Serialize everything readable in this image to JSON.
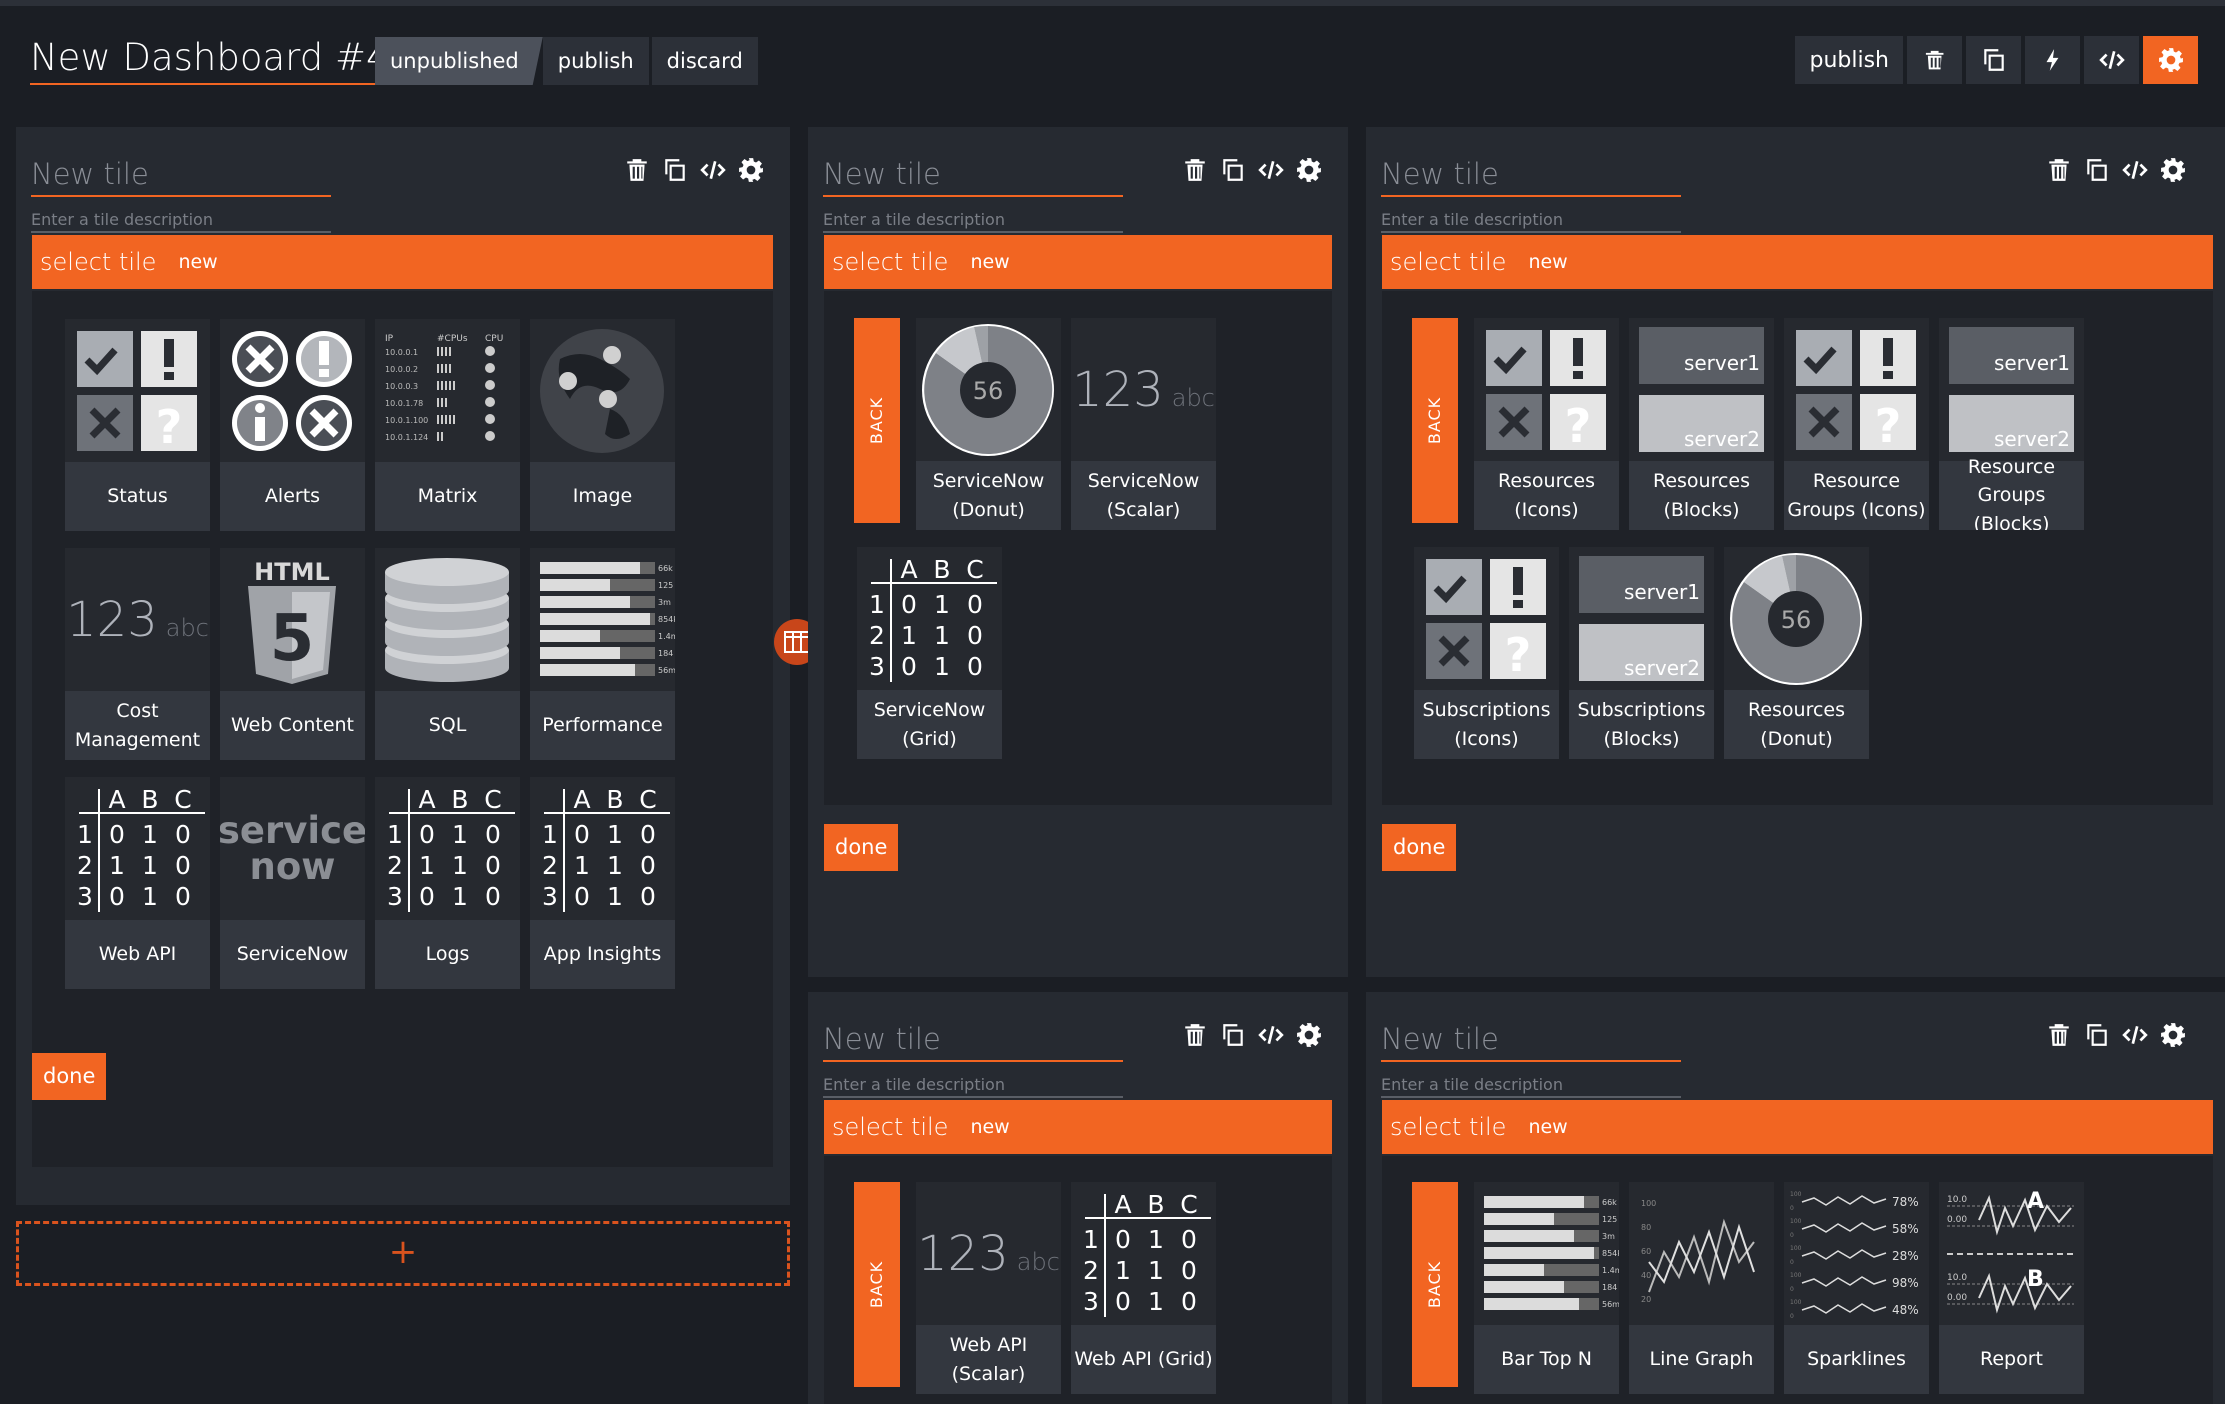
{
  "header": {
    "title": "New Dashboard #4",
    "state_label": "unpublished",
    "publish_label": "publish",
    "discard_label": "discard",
    "toolbar": {
      "publish_label": "publish",
      "icons": [
        "trash-icon",
        "copy-icon",
        "bolt-icon",
        "code-icon",
        "gear-icon"
      ]
    }
  },
  "tile_common": {
    "title_placeholder": "New tile",
    "desc_placeholder": "Enter a tile description",
    "select_label": "select tile",
    "new_label": "new",
    "done_label": "done",
    "back_label": "BACK"
  },
  "tiles": {
    "t1": {
      "cards": [
        "Status",
        "Alerts",
        "Matrix",
        "Image",
        "Cost Management",
        "Web Content",
        "SQL",
        "Performance",
        "Web API",
        "ServiceNow",
        "Logs",
        "App Insights"
      ]
    },
    "t2": {
      "cards": [
        "ServiceNow (Donut)",
        "ServiceNow (Scalar)",
        "ServiceNow (Grid)"
      ]
    },
    "t3": {
      "cards": [
        "Resources (Icons)",
        "Resources (Blocks)",
        "Resource Groups (Icons)",
        "Resource Groups (Blocks)",
        "Subscriptions (Icons)",
        "Subscriptions (Blocks)",
        "Resources (Donut)"
      ]
    },
    "t4": {
      "cards": [
        "Web API (Scalar)",
        "Web API (Grid)"
      ]
    },
    "t5": {
      "cards": [
        "Bar Top N",
        "Line Graph",
        "Sparklines",
        "Report"
      ]
    }
  },
  "icon_text": {
    "scalar_num": "123",
    "scalar_unit": "abc",
    "donut_value": "56",
    "server1": "server1",
    "server2": "server2",
    "html_label": "HTML",
    "servicenow_word1": "service",
    "servicenow_word2": "now",
    "grid_cols": [
      "A",
      "B",
      "C"
    ],
    "grid_rows": [
      "1",
      "2",
      "3"
    ],
    "grid_vals": [
      [
        "0",
        "1",
        "0"
      ],
      [
        "1",
        "1",
        "0"
      ],
      [
        "0",
        "1",
        "0"
      ]
    ],
    "matrix_headers": [
      "IP",
      "#CPUs",
      "CPU"
    ],
    "matrix_ips": [
      "10.0.0.1",
      "10.0.0.2",
      "10.0.0.3",
      "10.0.1.78",
      "10.0.1.100",
      "10.0.1.124"
    ],
    "perf_values": [
      "66k",
      "125",
      "3m",
      "854k",
      "1.4m",
      "184",
      "56m"
    ],
    "line_ticks": [
      "100",
      "80",
      "60",
      "40",
      "20"
    ],
    "spark_values": [
      "78%",
      "58%",
      "28%",
      "98%",
      "48%"
    ],
    "spark_ticks": [
      "100",
      "0"
    ],
    "report_ticks": [
      "10.0",
      "0.00"
    ],
    "report_letters": [
      "A",
      "B"
    ]
  },
  "add_tile_label": "+",
  "colors": {
    "accent": "#f26522",
    "panel": "#262a31",
    "background": "#1b1e24"
  }
}
